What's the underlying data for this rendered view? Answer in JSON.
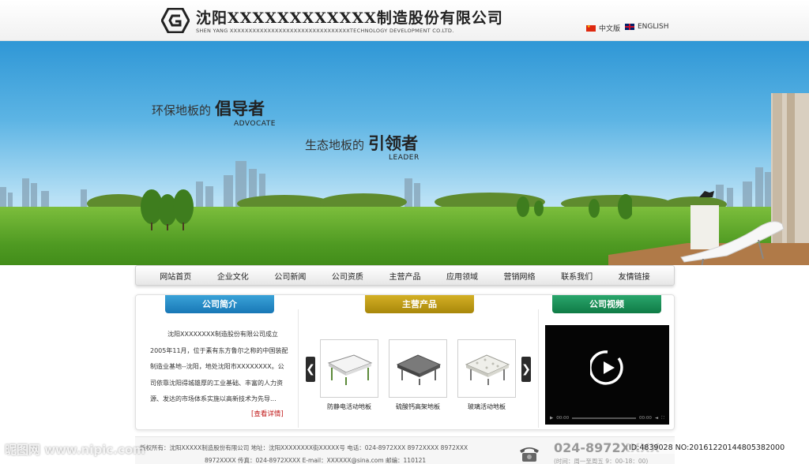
{
  "header": {
    "title": "沈阳XXXXXXXXXXXX制造股份有限公司",
    "subtitle": "SHEN YANG XXXXXXXXXXXXXXXXXXXXXXXXXXXXXXXXTECHNOLOGY DEVELOPMENT CO.LTD.",
    "lang_cn": "中文版",
    "lang_en": "ENGLISH"
  },
  "banner": {
    "slogan1_small": "环保地板的",
    "slogan1_big": "倡导者",
    "slogan1_en": "ADVOCATE",
    "slogan2_small": "生态地板的",
    "slogan2_big": "引领者",
    "slogan2_en": "LEADER"
  },
  "nav": {
    "items": [
      "网站首页",
      "企业文化",
      "公司新闻",
      "公司资质",
      "主营产品",
      "应用领域",
      "营销网络",
      "联系我们",
      "友情链接"
    ]
  },
  "intro": {
    "title": "公司简介",
    "text": "沈阳XXXXXXXX制造股份有限公司成立2005年11月，位于素有东方鲁尔之称的中国装配制造业基地--沈阳，地处沈阳市XXXXXXXX。公司依靠沈阳得城雄厚的工业基础、丰富的人力资源、发达的市场体系实施以高新技术为先导...",
    "more": "[查看详情]"
  },
  "products": {
    "title": "主营产品",
    "prev": "❮",
    "next": "❯",
    "items": [
      "防静电活动地板",
      "硫酸钙高架地板",
      "玻璃活动地板"
    ]
  },
  "video": {
    "title": "公司视频",
    "time_left": "00:00",
    "time_right": "00:00"
  },
  "footer": {
    "line1": "版权所有：沈阳XXXXX制造股份有限公司    地址：沈阳XXXXXXXX街XXXXX号    电话：024-8972XXX  8972XXXX  8972XXX",
    "line2": "8972XXXX    传真：024-8972XXXX    E-mail：XXXXXX@sina.com    邮编：110121",
    "phone": "024-8972XXXX",
    "hours": "(时间：周一至周五 9：00-18：00)"
  },
  "watermark": {
    "left": "昵图网 www.nipic.com",
    "right": "ID:4839028 NO:20161220144805382000"
  },
  "colors": {
    "tab_blue": "#1f86c4",
    "tab_gold": "#b99510",
    "tab_green": "#1a8c55",
    "more_link": "#c01818"
  }
}
